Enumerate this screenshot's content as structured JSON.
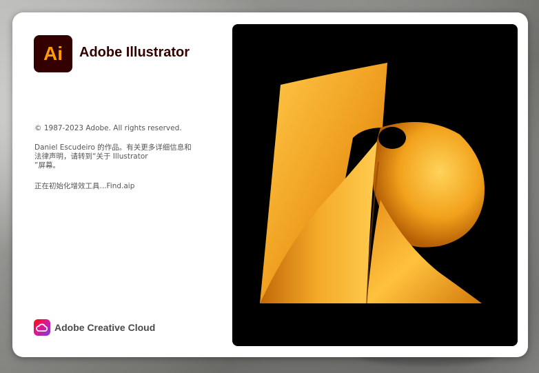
{
  "app": {
    "logo_text": "Ai",
    "name": "Adobe Illustrator"
  },
  "legal": {
    "copyright": "© 1987-2023 Adobe. All rights reserved.",
    "credits_line1": "Daniel  Escudeiro 的作品。有关更多详细信息和",
    "credits_line2": "法律声明，请转到“关于  Illustrator",
    "credits_line3": "”屏幕。"
  },
  "status": {
    "loading_text": "正在初始化增效工具...Find.aip"
  },
  "footer": {
    "cc_label": "Adobe Creative Cloud"
  },
  "colors": {
    "brand_dark": "#330000",
    "brand_orange": "#ff9a00",
    "artwork_orange": "#f5a623"
  }
}
